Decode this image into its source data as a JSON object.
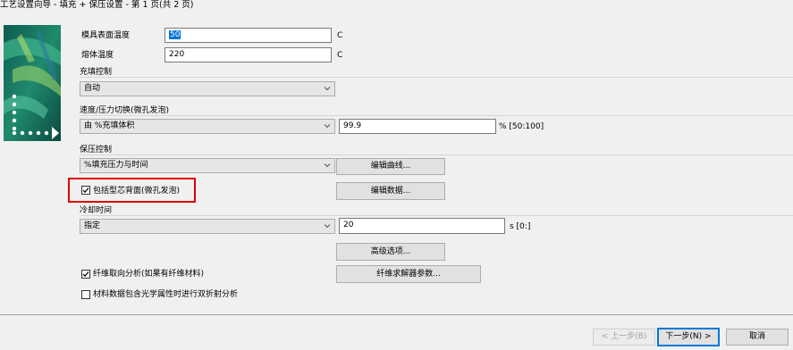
{
  "window": {
    "title": "工艺设置向导 - 填充 + 保压设置 - 第 1 页(共 2 页)"
  },
  "mold_temp": {
    "label": "模具表面温度",
    "value": "50",
    "unit": "C"
  },
  "melt_temp": {
    "label": "熔体温度",
    "value": "220",
    "unit": "C"
  },
  "fill_control": {
    "label": "充填控制",
    "value": "自动"
  },
  "vp_switch": {
    "label": "速度/压力切换(微孔发泡)",
    "mode": "由 %充填体积",
    "value": "99.9",
    "range": "% [50:100]"
  },
  "pack_control": {
    "label": "保压控制",
    "value": "%填充压力与时间",
    "edit_curve": "编辑曲线...",
    "edit_data": "编辑数据..."
  },
  "include_core": {
    "label": "包括型芯背面(微孔发泡)",
    "checked": true
  },
  "cooling": {
    "label": "冷却时间",
    "mode": "指定",
    "value": "20",
    "range": "s [0:]"
  },
  "advanced_button": "高级选项...",
  "fiber_orient": {
    "label": "纤维取向分析(如果有纤维材料)",
    "checked": true
  },
  "fiber_solver_button": "纤维求解器参数...",
  "birefringence": {
    "label": "材料数据包含光学属性时进行双折射分析",
    "checked": false
  },
  "footer": {
    "back": "< 上一步(B)",
    "next": "下一步(N) >",
    "cancel": "取消"
  },
  "colors": {
    "highlight_box": "#e00000",
    "selection": "#0078d7",
    "window_bg": "#f0f0f0"
  }
}
